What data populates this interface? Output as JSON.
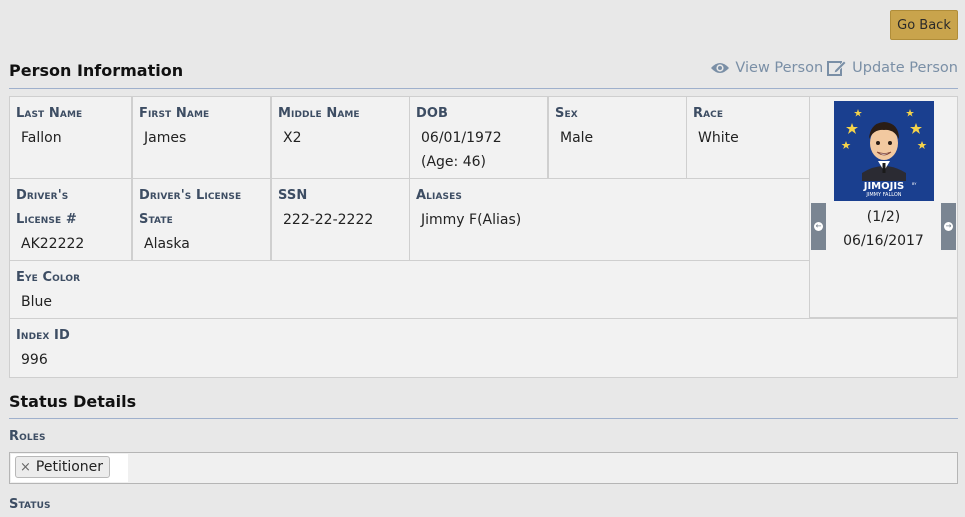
{
  "header": {
    "go_back_label": "Go Back"
  },
  "person_section": {
    "title": "Person Information",
    "actions": {
      "view_label": "View Person",
      "update_label": "Update Person",
      "view_icon": "eye-icon",
      "update_icon": "edit-icon"
    }
  },
  "fields": {
    "last_name": {
      "label": "Last Name",
      "value": "Fallon"
    },
    "first_name": {
      "label": "First Name",
      "value": "James"
    },
    "middle_name": {
      "label": "Middle Name",
      "value": "X2"
    },
    "dob": {
      "label": "DOB",
      "value": "06/01/1972",
      "age": "(Age: 46)"
    },
    "sex": {
      "label": "Sex",
      "value": "Male"
    },
    "race": {
      "label": "Race",
      "value": "White"
    },
    "drivers_license_no": {
      "label_line1": "Driver's",
      "label_line2": "License #",
      "value": "AK22222"
    },
    "drivers_license_state": {
      "label_line1": "Driver's License",
      "label_line2": "State",
      "value": "Alaska"
    },
    "ssn": {
      "label": "SSN",
      "value": "222-22-2222"
    },
    "aliases": {
      "label": "Aliases",
      "value": "Jimmy F(Alias)"
    },
    "eye_color": {
      "label": "Eye Color",
      "value": "Blue"
    },
    "index_id": {
      "label": "Index ID",
      "value": "996"
    }
  },
  "photo": {
    "counter": "(1/2)",
    "date": "06/16/2017",
    "logo_line1": "JIMOJIS",
    "logo_by": "BY",
    "logo_line2": "JIMMY FALLON",
    "bg_color": "#1a3f8f"
  },
  "status_section": {
    "title": "Status Details",
    "roles_label": "Roles",
    "roles": [
      {
        "label": "Petitioner",
        "remove_glyph": "×"
      }
    ],
    "status_label": "Status"
  },
  "colors": {
    "accent_gold": "#c9a44c",
    "label_blue": "#3d4d63",
    "link_gray": "#7a8fa6"
  }
}
